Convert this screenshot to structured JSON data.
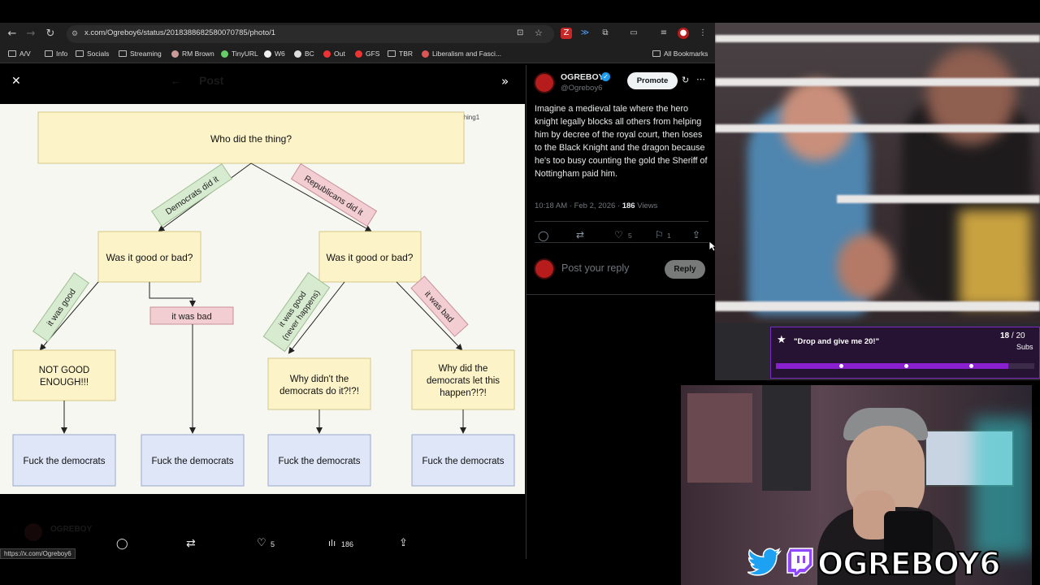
{
  "browser": {
    "url": "x.com/Ogreboy6/status/2018388682580070785/photo/1",
    "bookmarks": [
      "A/V",
      "Info",
      "Socials",
      "Streaming",
      "RM Brown",
      "TinyURL",
      "W6",
      "BC",
      "Out",
      "GFS",
      "TBR",
      "Liberalism and Fasci..."
    ],
    "all_bookmarks": "All Bookmarks",
    "status_url": "https://x.com/Ogreboy6"
  },
  "post": {
    "author_name": "OGREBOY",
    "handle": "@Ogreboy6",
    "promote_label": "Promote",
    "text": "Imagine a medieval tale where the hero knight legally blocks all others from helping him by decree of the royal court, then loses to the Black Knight and the dragon because he's too busy counting the gold the Sheriff of Nottingham paid him.",
    "time": "10:18 AM · Feb 2, 2026 · ",
    "views_count": "186",
    "views_label": " Views",
    "likes": "5",
    "bookmarks": "1",
    "reply_placeholder": "Post your reply",
    "reply_button": "Reply",
    "bg_header": "Post",
    "bg_author": "OGREBOY"
  },
  "bottom_actions": {
    "likes": "5",
    "views": "186"
  },
  "diagram": {
    "watermark": "@KnowN0thing1",
    "root": "Who did the thing?",
    "left_branch": "Democrats did it",
    "right_branch": "Republicans did it",
    "q_left": "Was it good or bad?",
    "q_right": "Was it good or bad?",
    "l_good": "it was good",
    "l_bad": "it was bad",
    "r_good_1": "it was good",
    "r_good_2": "(never happens)",
    "r_bad": "it was bad",
    "box1_1": "NOT GOOD",
    "box1_2": "ENOUGH!!!",
    "box3_1": "Why didn't the",
    "box3_2": "democrats do it?!?!",
    "box4_1": "Why did the",
    "box4_2": "democrats let this",
    "box4_3": "happen?!?!",
    "bottom": [
      "Fuck the democrats",
      "Fuck the democrats",
      "Fuck the democrats",
      "Fuck the democrats"
    ]
  },
  "sub_goal": {
    "title": "\"Drop and give me 20!\"",
    "current": "18",
    "total": " / 20",
    "label": "Subs",
    "progress": 0.9
  },
  "brand": {
    "name": "OGREBOY6"
  },
  "colors": {
    "accent": "#1d9bf0",
    "goal_bar": "#8a1fd0",
    "yellow_box": "#fcf3c8",
    "blue_box": "#dfe6f7",
    "green_tag": "#d6ebcf",
    "red_tag": "#f2cdd2"
  }
}
